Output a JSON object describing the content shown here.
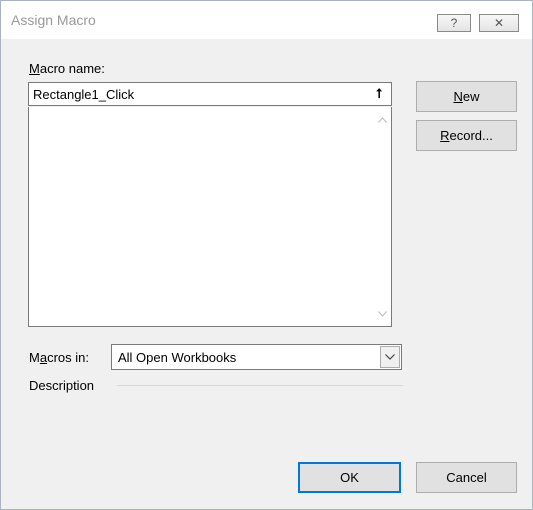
{
  "window": {
    "title": "Assign Macro",
    "help_glyph": "?",
    "close_glyph": "✕"
  },
  "macro_name": {
    "label_accel": "M",
    "label_rest": "acro name:",
    "value": "Rectangle1_Click",
    "collapse_glyph": "⭡"
  },
  "macro_list": {
    "items": []
  },
  "buttons": {
    "new": {
      "accel": "N",
      "rest": "ew"
    },
    "record": {
      "accel": "R",
      "rest": "ecord..."
    },
    "ok": "OK",
    "cancel": "Cancel"
  },
  "macros_in": {
    "label_pre": "M",
    "label_accel": "a",
    "label_post": "cros in:",
    "selected": "All Open Workbooks"
  },
  "description": {
    "label": "Description"
  }
}
